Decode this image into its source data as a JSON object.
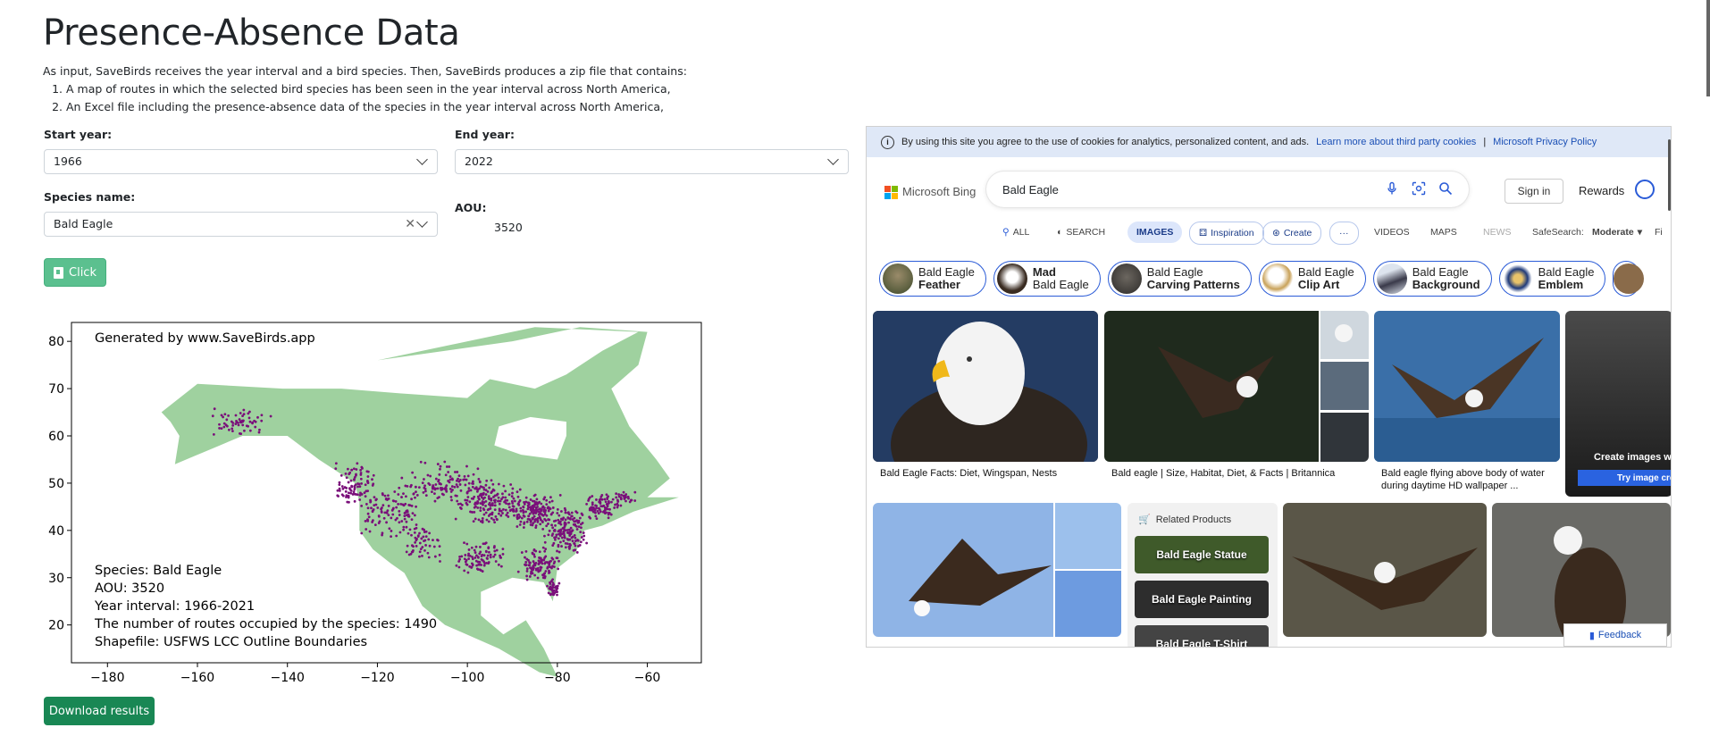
{
  "page": {
    "title": "Presence-Absence Data",
    "intro": "As input, SaveBirds receives the year interval and a bird species. Then, SaveBirds produces a zip file that contains:",
    "list": [
      "A map of routes in which the selected bird species has been seen in the year interval across North America,",
      "An Excel file including the presence-absence data of the species in the year interval across North America,"
    ]
  },
  "form": {
    "start_year_label": "Start year:",
    "start_year_value": "1966",
    "end_year_label": "End year:",
    "end_year_value": "2022",
    "species_label": "Species name:",
    "species_value": "Bald Eagle",
    "aou_label": "AOU:",
    "aou_value": "3520",
    "click_label": "Click",
    "download_label": "Download results"
  },
  "chart_data": {
    "type": "scatter",
    "title": "Generated by www.SaveBirds.app",
    "xlabel": "",
    "ylabel": "",
    "xlim": [
      -188,
      -48
    ],
    "ylim": [
      12,
      84
    ],
    "xticks": [
      -180,
      -160,
      -140,
      -120,
      -100,
      -80,
      -60
    ],
    "yticks": [
      20,
      30,
      40,
      50,
      60,
      70,
      80
    ],
    "land_color": "#9fd19f",
    "point_color": "#7a0f7a",
    "annotations": [
      "Species: Bald Eagle",
      "AOU: 3520",
      "Year interval: 1966-2021",
      "The number of routes occupied by the species: 1490",
      "Shapefile: USFWS LCC Outline Boundaries"
    ],
    "point_clusters": [
      {
        "lon": -150,
        "lat": 63,
        "spread_lon": 8,
        "spread_lat": 3,
        "count": 60
      },
      {
        "lon": -125,
        "lat": 50,
        "spread_lon": 5,
        "spread_lat": 5,
        "count": 90
      },
      {
        "lon": -117,
        "lat": 44,
        "spread_lon": 8,
        "spread_lat": 6,
        "count": 110
      },
      {
        "lon": -105,
        "lat": 50,
        "spread_lon": 10,
        "spread_lat": 5,
        "count": 120
      },
      {
        "lon": -95,
        "lat": 46,
        "spread_lon": 8,
        "spread_lat": 5,
        "count": 170
      },
      {
        "lon": -85,
        "lat": 44,
        "spread_lon": 6,
        "spread_lat": 4,
        "count": 160
      },
      {
        "lon": -78,
        "lat": 40,
        "spread_lon": 5,
        "spread_lat": 5,
        "count": 160
      },
      {
        "lon": -70,
        "lat": 45,
        "spread_lon": 4,
        "spread_lat": 3,
        "count": 80
      },
      {
        "lon": -84,
        "lat": 33,
        "spread_lon": 5,
        "spread_lat": 4,
        "count": 110
      },
      {
        "lon": -97,
        "lat": 34,
        "spread_lon": 6,
        "spread_lat": 4,
        "count": 90
      },
      {
        "lon": -81,
        "lat": 28,
        "spread_lon": 1.5,
        "spread_lat": 2,
        "count": 40
      },
      {
        "lon": -110,
        "lat": 37,
        "spread_lon": 5,
        "spread_lat": 4,
        "count": 50
      },
      {
        "lon": -65,
        "lat": 47,
        "spread_lon": 3,
        "spread_lat": 2,
        "count": 30
      }
    ]
  },
  "bing": {
    "cookie_text": "By using this site you agree to the use of cookies for analytics, personalized content, and ads.",
    "cookie_link1": "Learn more about third party cookies",
    "cookie_sep": "|",
    "cookie_link2": "Microsoft Privacy Policy",
    "logo": "Microsoft Bing",
    "query": "Bald Eagle",
    "sign_in": "Sign in",
    "rewards": "Rewards",
    "tabs": [
      "ALL",
      "SEARCH",
      "IMAGES",
      "Inspiration",
      "Create",
      "···",
      "VIDEOS",
      "MAPS",
      "NEWS"
    ],
    "safesearch_label": "SafeSearch:",
    "safesearch_value": "Moderate",
    "filter_label": "Fi",
    "chips": [
      {
        "a": "Bald Eagle",
        "b": "Feather"
      },
      {
        "a": "Mad",
        "b": "Bald Eagle"
      },
      {
        "a": "Bald Eagle",
        "b": "Carving Patterns"
      },
      {
        "a": "Bald Eagle",
        "b": "Clip Art"
      },
      {
        "a": "Bald Eagle",
        "b": "Background"
      },
      {
        "a": "Bald Eagle",
        "b": "Emblem"
      }
    ],
    "captions": [
      "Bald Eagle Facts: Diet, Wingspan, Nests",
      "Bald eagle | Size, Habitat, Diet, & Facts | Britannica",
      "Bald eagle flying above body of water during daytime HD wallpaper ..."
    ],
    "create_text": "Create images w",
    "try_text": "Try image cre",
    "related_title": "Related Products",
    "related": [
      "Bald Eagle Statue",
      "Bald Eagle Painting",
      "Bald Eagle T-Shirt"
    ],
    "feedback": "Feedback"
  }
}
